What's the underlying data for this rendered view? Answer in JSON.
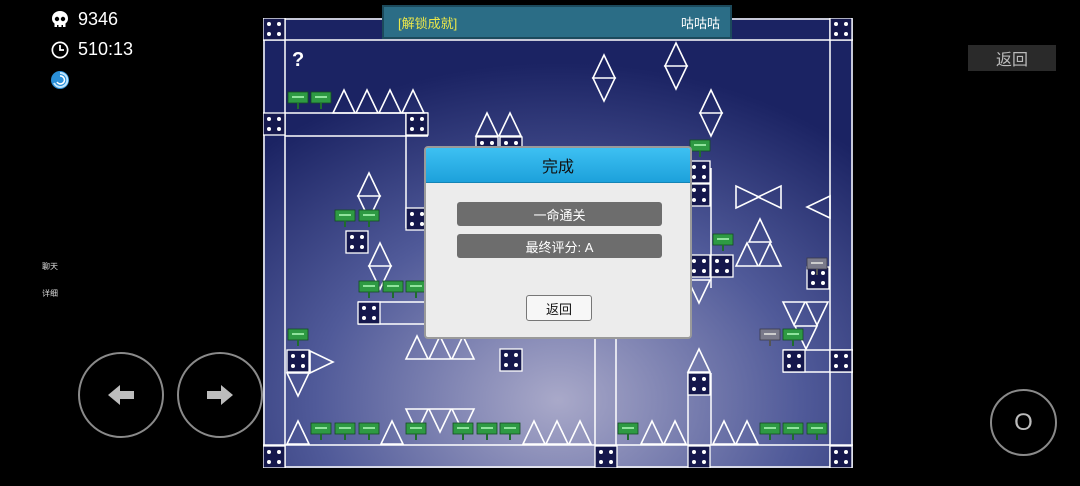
{
  "hud": {
    "deaths": "9346",
    "time": "510:13",
    "deaths_icon": "skull-icon",
    "time_icon": "clock-icon",
    "swirl_icon": "swirl-icon"
  },
  "side_menu": {
    "chat": "聊天",
    "details": "详细"
  },
  "top_right": {
    "return_label": "返回"
  },
  "achievement_banner": {
    "text": "[解锁成就]",
    "user": "咕咕咕"
  },
  "level": {
    "hint_marker": "?"
  },
  "dialog": {
    "title": "完成",
    "line1": "一命通关",
    "line2": "最终评分: A",
    "return_label": "返回"
  },
  "controls": {
    "left_icon": "arrow-left-icon",
    "right_icon": "arrow-right-icon",
    "jump_label": "O"
  },
  "colors": {
    "banner_bg": "#2b6d86",
    "achievement_text": "#e9e64b",
    "dialog_title_bg": "#29b3ea",
    "sign_green": "#2e9a43"
  }
}
